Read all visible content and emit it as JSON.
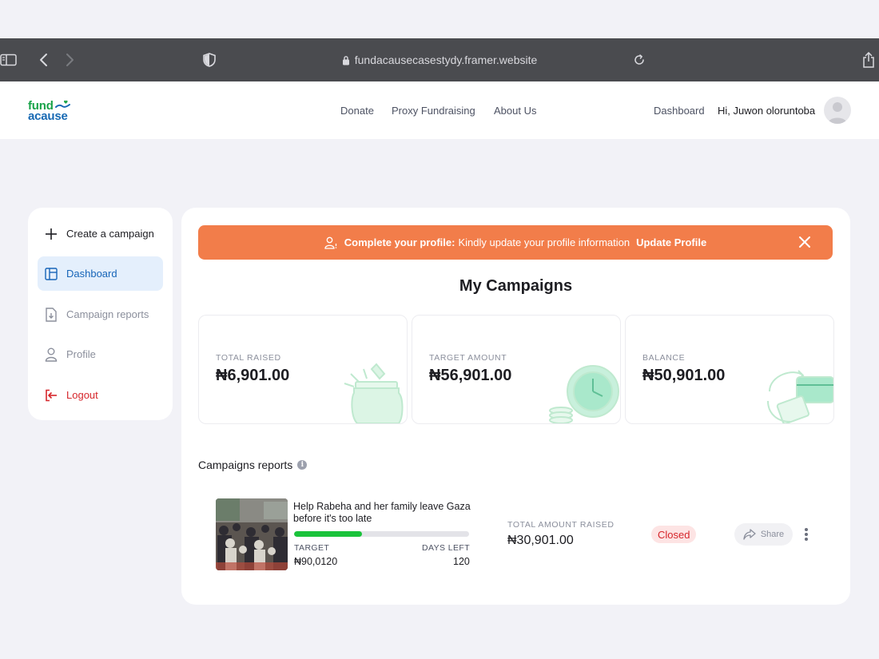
{
  "browser": {
    "url": "fundacausecasestydy.framer.website"
  },
  "header": {
    "logo_line1": "fund",
    "logo_line2": "acause",
    "nav": [
      "Donate",
      "Proxy Fundraising",
      "About Us"
    ],
    "dashboard_link": "Dashboard",
    "greeting": "Hi, Juwon oloruntoba"
  },
  "sidebar": {
    "items": [
      {
        "label": "Create a campaign",
        "icon": "plus-icon"
      },
      {
        "label": "Dashboard",
        "icon": "layout-icon"
      },
      {
        "label": "Campaign reports",
        "icon": "report-download-icon"
      },
      {
        "label": "Profile",
        "icon": "user-icon"
      },
      {
        "label": "Logout",
        "icon": "logout-icon"
      }
    ]
  },
  "banner": {
    "bold": "Complete your profile:",
    "message": "Kindly update your profile information",
    "action": "Update Profile",
    "color": "#f27d4a"
  },
  "main": {
    "title": "My Campaigns",
    "stats": [
      {
        "label": "TOTAL RAISED",
        "value": "₦6,901.00"
      },
      {
        "label": "TARGET AMOUNT",
        "value": "₦56,901.00"
      },
      {
        "label": "BALANCE",
        "value": "₦50,901.00"
      }
    ],
    "reports_title": "Campaigns reports"
  },
  "campaign": {
    "title": "Help Rabeha and her family leave Gaza before it's too late",
    "progress": 0.39,
    "target_label": "TARGET",
    "target_value": "₦90,0120",
    "days_left_label": "DAYS LEFT",
    "days_left_value": "120",
    "raised_label": "TOTAL AMOUNT RAISED",
    "raised_value": "₦30,901.00",
    "status": "Closed",
    "share_label": "Share"
  },
  "colors": {
    "accent_blue": "#1765b8",
    "progress_green": "#1ac33b",
    "closed_red": "#d6262b"
  }
}
